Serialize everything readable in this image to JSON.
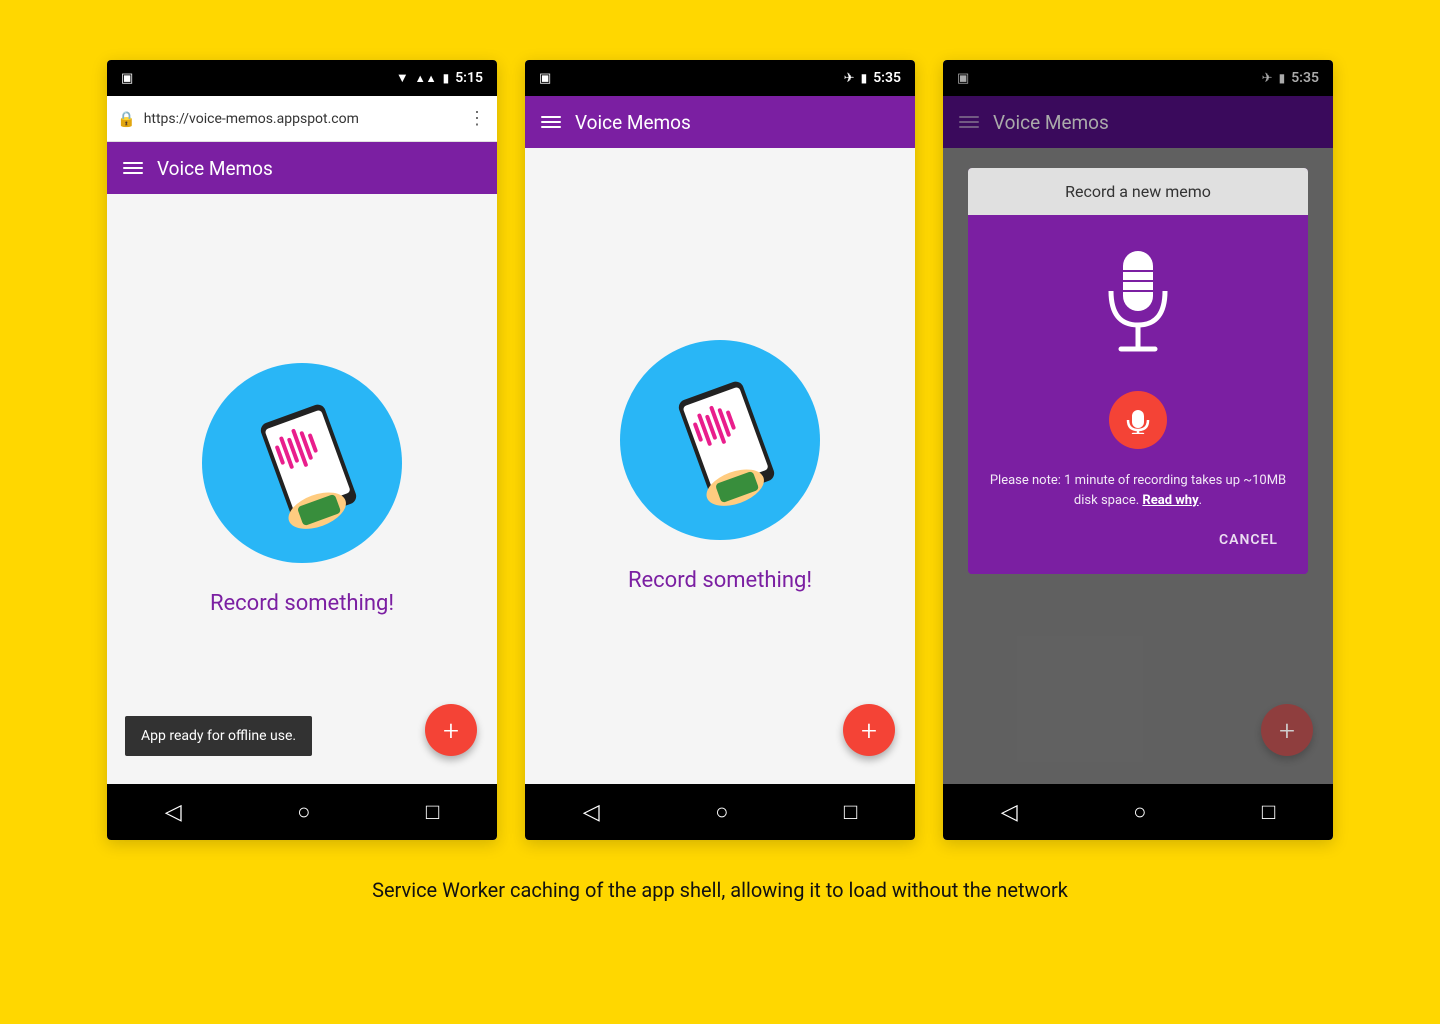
{
  "phone1": {
    "status_bar": {
      "time": "5:15",
      "icons": [
        "wifi",
        "signal",
        "battery"
      ]
    },
    "url_bar": {
      "url": "https://voice-memos.appspot.com",
      "lock": "🔒"
    },
    "app_bar": {
      "title": "Voice Memos"
    },
    "content": {
      "record_label": "Record something!"
    },
    "fab_label": "+",
    "snackbar": "App ready for offline use.",
    "nav_buttons": [
      "◁",
      "○",
      "□"
    ]
  },
  "phone2": {
    "status_bar": {
      "time": "5:35",
      "icons": [
        "airplane",
        "battery"
      ]
    },
    "app_bar": {
      "title": "Voice Memos"
    },
    "content": {
      "record_label": "Record something!"
    },
    "fab_label": "+",
    "nav_buttons": [
      "◁",
      "○",
      "□"
    ]
  },
  "phone3": {
    "status_bar": {
      "time": "5:35",
      "icons": [
        "airplane",
        "battery"
      ]
    },
    "app_bar": {
      "title": "Voice Memos"
    },
    "dialog": {
      "title": "Record a new memo",
      "note": "Please note: 1 minute of recording takes up ~10MB disk space.",
      "note_link": "Read why",
      "cancel_button": "CANCEL"
    },
    "fab_label": "+",
    "nav_buttons": [
      "◁",
      "○",
      "□"
    ]
  },
  "caption": "Service Worker caching of the app shell, allowing it to load without the network"
}
